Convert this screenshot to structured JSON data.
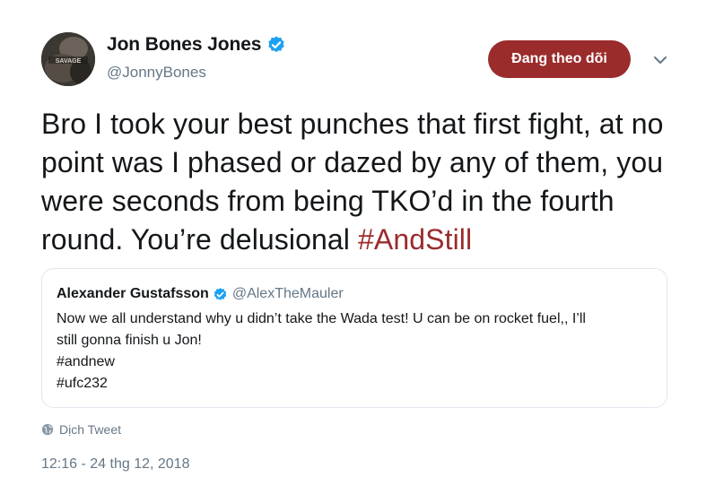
{
  "author": {
    "display_name": "Jon Bones Jones",
    "handle": "@JonnyBones",
    "avatar_text": "SAVAGE"
  },
  "follow_button": {
    "label": "Đang theo dõi"
  },
  "tweet": {
    "text_before_hashtag": "Bro I took your best punches that first fight, at no point was I phased or dazed by any of them, you were seconds from being TKO’d in the fourth round. You’re delusional ",
    "hashtag": "#AndStill"
  },
  "quoted_tweet": {
    "display_name": "Alexander Gustafsson",
    "handle": "@AlexTheMauler",
    "lines": [
      "Now we all understand why u didn’t take the Wada test! U can be on rocket fuel,, I’ll",
      "still gonna finish u Jon!",
      "#andnew",
      "#ufc232"
    ]
  },
  "translate": {
    "label": "Dịch Tweet",
    "icon": "globe-icon"
  },
  "timestamp": "12:16 - 24 thg 12, 2018",
  "colors": {
    "accent": "#9b2c2c",
    "verified_blue": "#1da1f2",
    "secondary_text": "#657786",
    "border": "#e1e8ed"
  }
}
